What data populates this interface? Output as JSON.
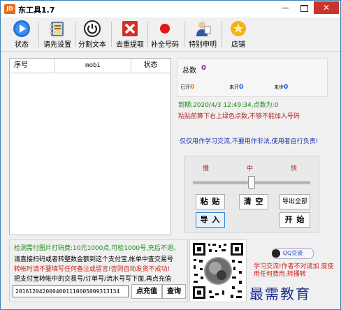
{
  "window": {
    "title": "东工具1.7",
    "icon_text": "JD",
    "min_symbol": "—",
    "close_symbol": "✕"
  },
  "toolbar": {
    "items": [
      {
        "label": "状态",
        "icon": "play-icon",
        "color": "#1e73d6"
      },
      {
        "label": "请先设置",
        "icon": "notebook-icon",
        "color": "#4a78b8"
      },
      {
        "label": "分割文本",
        "icon": "power-icon",
        "color": "#222222"
      },
      {
        "label": "去重提取",
        "icon": "close-x-icon",
        "color": "#d4302a"
      },
      {
        "label": "补全号码",
        "icon": "red-dot-icon",
        "color": "#e01818"
      },
      {
        "label": "特别申明",
        "icon": "person-icon",
        "color": "#2a5aa8"
      },
      {
        "label": "店铺",
        "icon": "star-icon",
        "color": "#f2b21c"
      }
    ]
  },
  "list": {
    "headers": {
      "seq": "序号",
      "mobi": "mobi",
      "status": "状态"
    }
  },
  "stats": {
    "total_label": "总数",
    "total_value": "0",
    "items": [
      {
        "label": "已开",
        "value": "0"
      },
      {
        "label": "未开",
        "value": "0"
      },
      {
        "label": "未步",
        "value": "0"
      }
    ]
  },
  "info": {
    "expire": "到期:2020/4/3 12:49:34,点数为:0",
    "warning": "粘贴前算下右上绿色点数,不够不能加入号码",
    "notice": "仅仅用作学习交流,不要用作非法,使用者自行负责!"
  },
  "controls": {
    "speed_slow": "慢",
    "speed_mid": "中",
    "speed_fast": "快",
    "speed_level": 0.5,
    "paste": "粘 贴",
    "clear": "清 空",
    "export_all": "导出全部",
    "import": "导 入",
    "start": "开 始"
  },
  "recharge": {
    "line1": "检测需付图片打码费:10元1000点,可检1000号,充后不退。",
    "line2": "请直接扫码或者转整数金额到这个支付宝,帐单中查交易号",
    "line3": "转帐时请不要填写任何备注或留言!否则自动发货不成功!",
    "line4": "把支付宝转帐中的交易号/订单号/流水号写下面,再点充值",
    "order_value": "2016120420004001110005009313134",
    "recharge_button": "点充值",
    "query_button": "查询"
  },
  "side": {
    "qq_label": "QQ交谈",
    "note": "学习交流!作者不对请加 度使用任何费用,转播转"
  },
  "watermark": "最需教育"
}
